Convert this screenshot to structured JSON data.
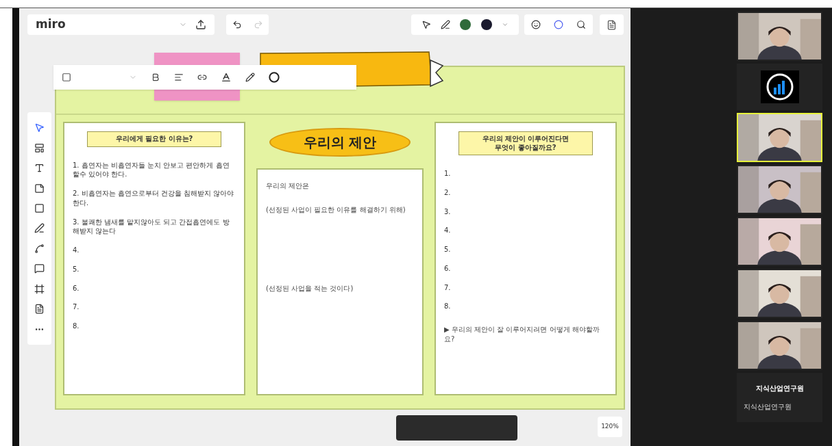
{
  "app": {
    "logo": "miro",
    "zoom": "120%"
  },
  "board": {
    "banner_title": "우리의 제안",
    "columns": [
      {
        "kind": "list",
        "heading": "우리에게 필요한 이유는?",
        "items": [
          "1. 흡연자는 비흡연자들 눈치 안보고 편안하게 흡연할수 있어야 한다.",
          "2. 비흡연자는 흡연으로부터 건강을 침해받지 않아야 한다.",
          "3. 불쾌한 냄새를 맡지않아도 되고 간접흡연에도 방해받지 않는다",
          "4.",
          "5.",
          "6.",
          "7.",
          "8."
        ]
      },
      {
        "kind": "proposal",
        "items": [
          "우리의 제안은",
          "(선정된 사업이 필요한 이유를 해결하기 위해)",
          "(선정된 사업을 적는 것이다)"
        ]
      },
      {
        "kind": "list",
        "heading": "우리의 제안이 이루어진다면\n무엇이 좋아질까요?",
        "items": [
          "1.",
          "2.",
          "3.",
          "4.",
          "5.",
          "6.",
          "7.",
          "8."
        ],
        "note": "▶ 우리의 제안이 잘 이루어지려면 어떻게 해야할까요?"
      }
    ]
  },
  "participants": [
    {
      "kind": "video",
      "highlighted": false
    },
    {
      "kind": "logo",
      "highlighted": false
    },
    {
      "kind": "video",
      "highlighted": true
    },
    {
      "kind": "video",
      "highlighted": false
    },
    {
      "kind": "video",
      "highlighted": false
    },
    {
      "kind": "video",
      "highlighted": false
    },
    {
      "kind": "video",
      "highlighted": false
    },
    {
      "kind": "name",
      "highlighted": false,
      "name": "지식산업연구원",
      "label": "지식산업연구원"
    }
  ]
}
